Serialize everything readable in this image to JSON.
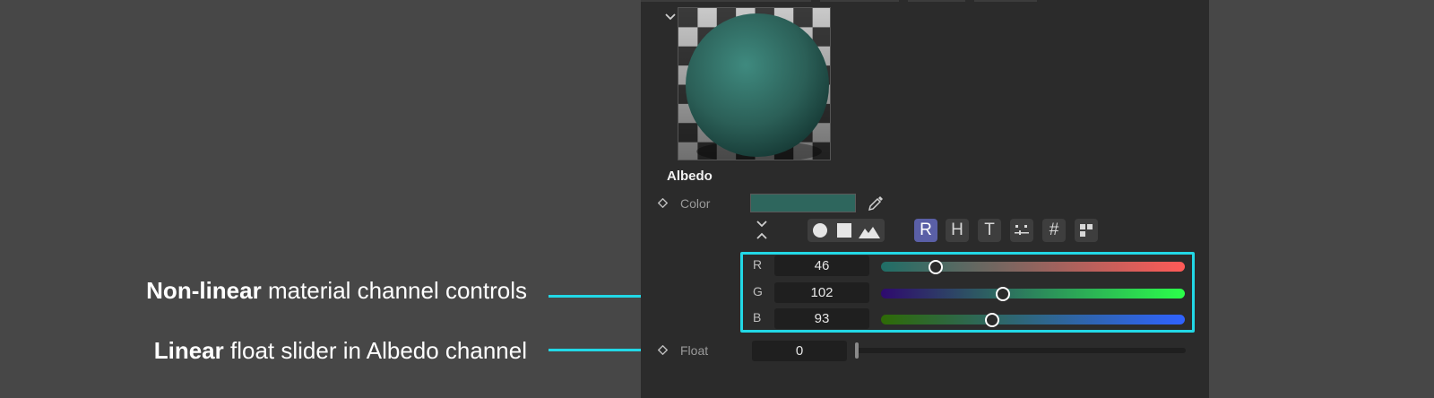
{
  "annotations": {
    "nonlinear": {
      "bold": "Non-linear",
      "rest": " material channel controls"
    },
    "linear": {
      "bold": "Linear",
      "rest": " float slider in Albedo channel"
    }
  },
  "panel": {
    "section_title": "Albedo",
    "color_row": {
      "label": "Color",
      "swatch_color": "#2e665d"
    },
    "mode_buttons": [
      "R",
      "H",
      "T",
      "#"
    ],
    "channels": [
      {
        "label": "R",
        "value": "46",
        "level": 0.18
      },
      {
        "label": "G",
        "value": "102",
        "level": 0.4
      },
      {
        "label": "B",
        "value": "93",
        "level": 0.365
      }
    ],
    "float_row": {
      "label": "Float",
      "value": "0",
      "level": 0.0
    }
  },
  "colors": {
    "accent": "#22d8e6",
    "active_button": "#5a5fa6",
    "panel_bg": "#2b2b2b"
  }
}
